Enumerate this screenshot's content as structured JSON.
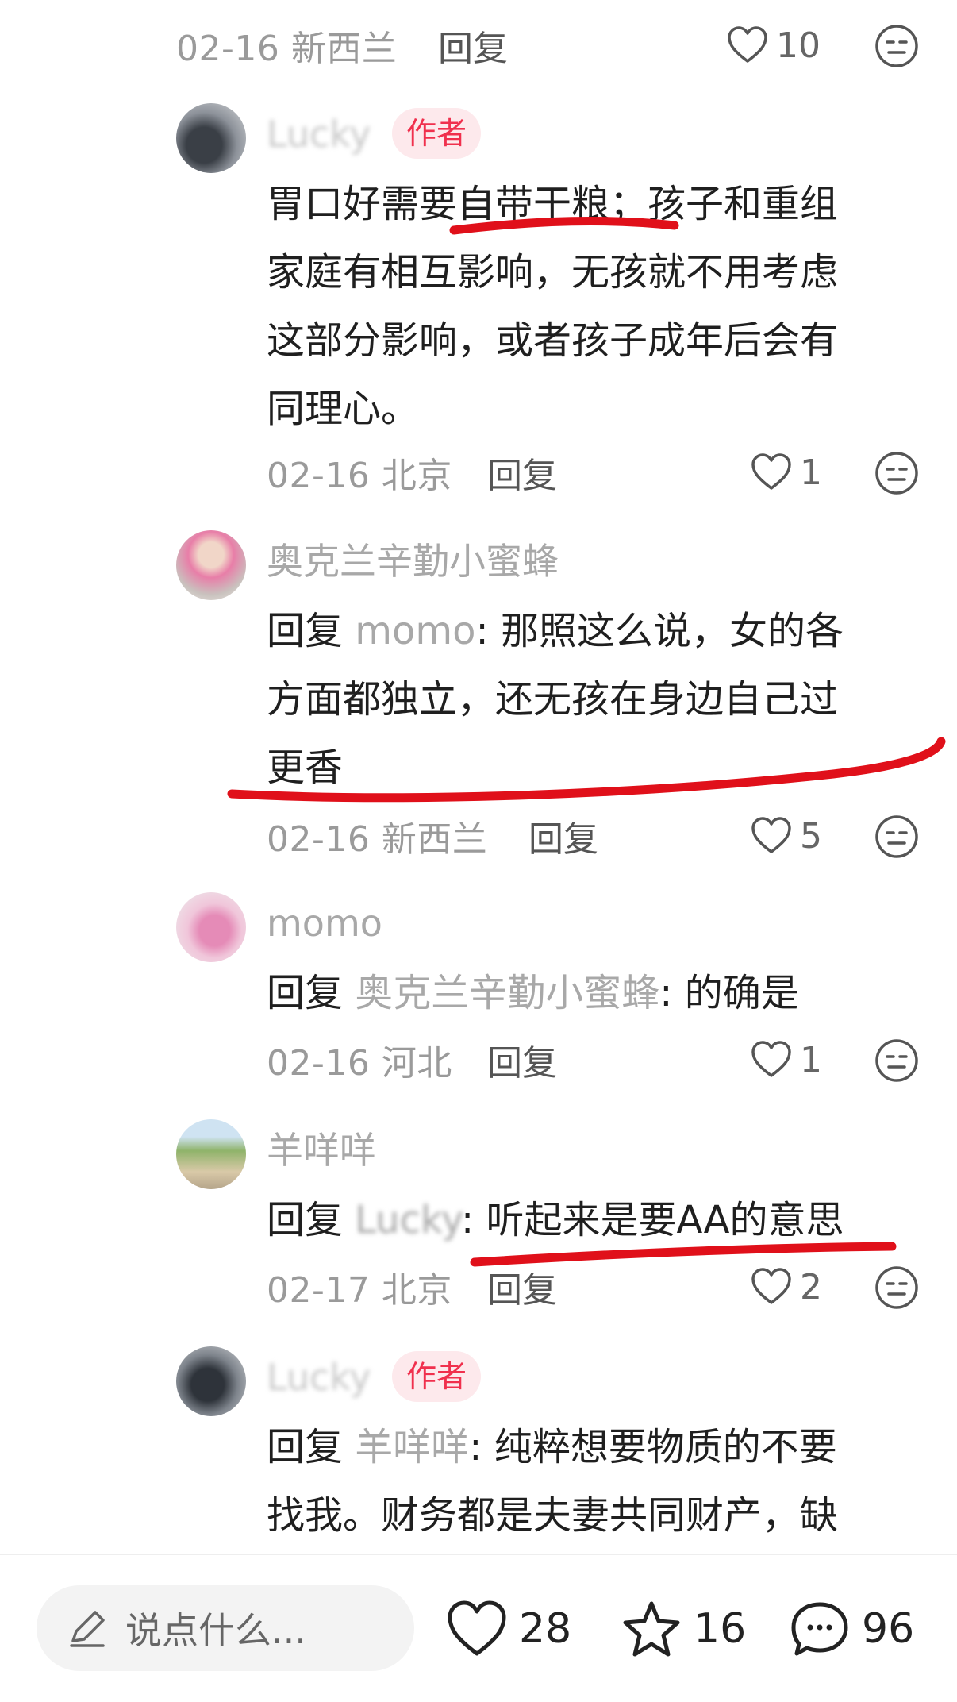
{
  "thread": {
    "top_meta": {
      "date": "02-16 新西兰",
      "reply": "回复",
      "likes": "10"
    },
    "comments": [
      {
        "username": "Lucky",
        "badge": "作者",
        "text": "胃口好需要自带干粮；孩子和重组家庭有相互影响，无孩就不用考虑这部分影响，或者孩子成年后会有同理心。",
        "lines": [
          "胃口好需要自带干粮；孩子和重组",
          "家庭有相互影响，无孩就不用考虑",
          "这部分影响，或者孩子成年后会有",
          "同理心。"
        ],
        "date": "02-16 北京",
        "reply": "回复",
        "likes": "1"
      },
      {
        "username": "奥克兰辛勤小蜜蜂",
        "reply_prefix": "回复",
        "reply_to": "momo",
        "lines": [
          "那照这么说，女的各",
          "方面都独立，还无孩在身边自己过",
          "更香"
        ],
        "date": "02-16 新西兰",
        "reply": "回复",
        "likes": "5"
      },
      {
        "username": "momo",
        "reply_prefix": "回复",
        "reply_to": "奥克兰辛勤小蜜蜂",
        "lines": [
          "的确是"
        ],
        "date": "02-16 河北",
        "reply": "回复",
        "likes": "1"
      },
      {
        "username": "羊咩咩",
        "reply_prefix": "回复",
        "reply_to": "Lucky",
        "lines": [
          "听起来是要AA的意思"
        ],
        "date": "02-17 北京",
        "reply": "回复",
        "likes": "2"
      },
      {
        "username": "Lucky",
        "badge": "作者",
        "reply_prefix": "回复",
        "reply_to": "羊咩咩",
        "lines": [
          "纯粹想要物质的不要",
          "找我。财务都是夫妻共同财产，缺"
        ]
      }
    ]
  },
  "bottom_bar": {
    "input_placeholder": "说点什么...",
    "likes": "28",
    "favorites": "16",
    "comments": "96"
  },
  "colors": {
    "author_badge_bg": "#fde9ec",
    "author_badge_text": "#f0304d",
    "annotation_red": "#e0101a",
    "muted_text": "#9a9a9a"
  },
  "icons": [
    "heart-icon",
    "neutral-face-icon",
    "pencil-icon",
    "star-icon",
    "chat-bubble-icon"
  ]
}
